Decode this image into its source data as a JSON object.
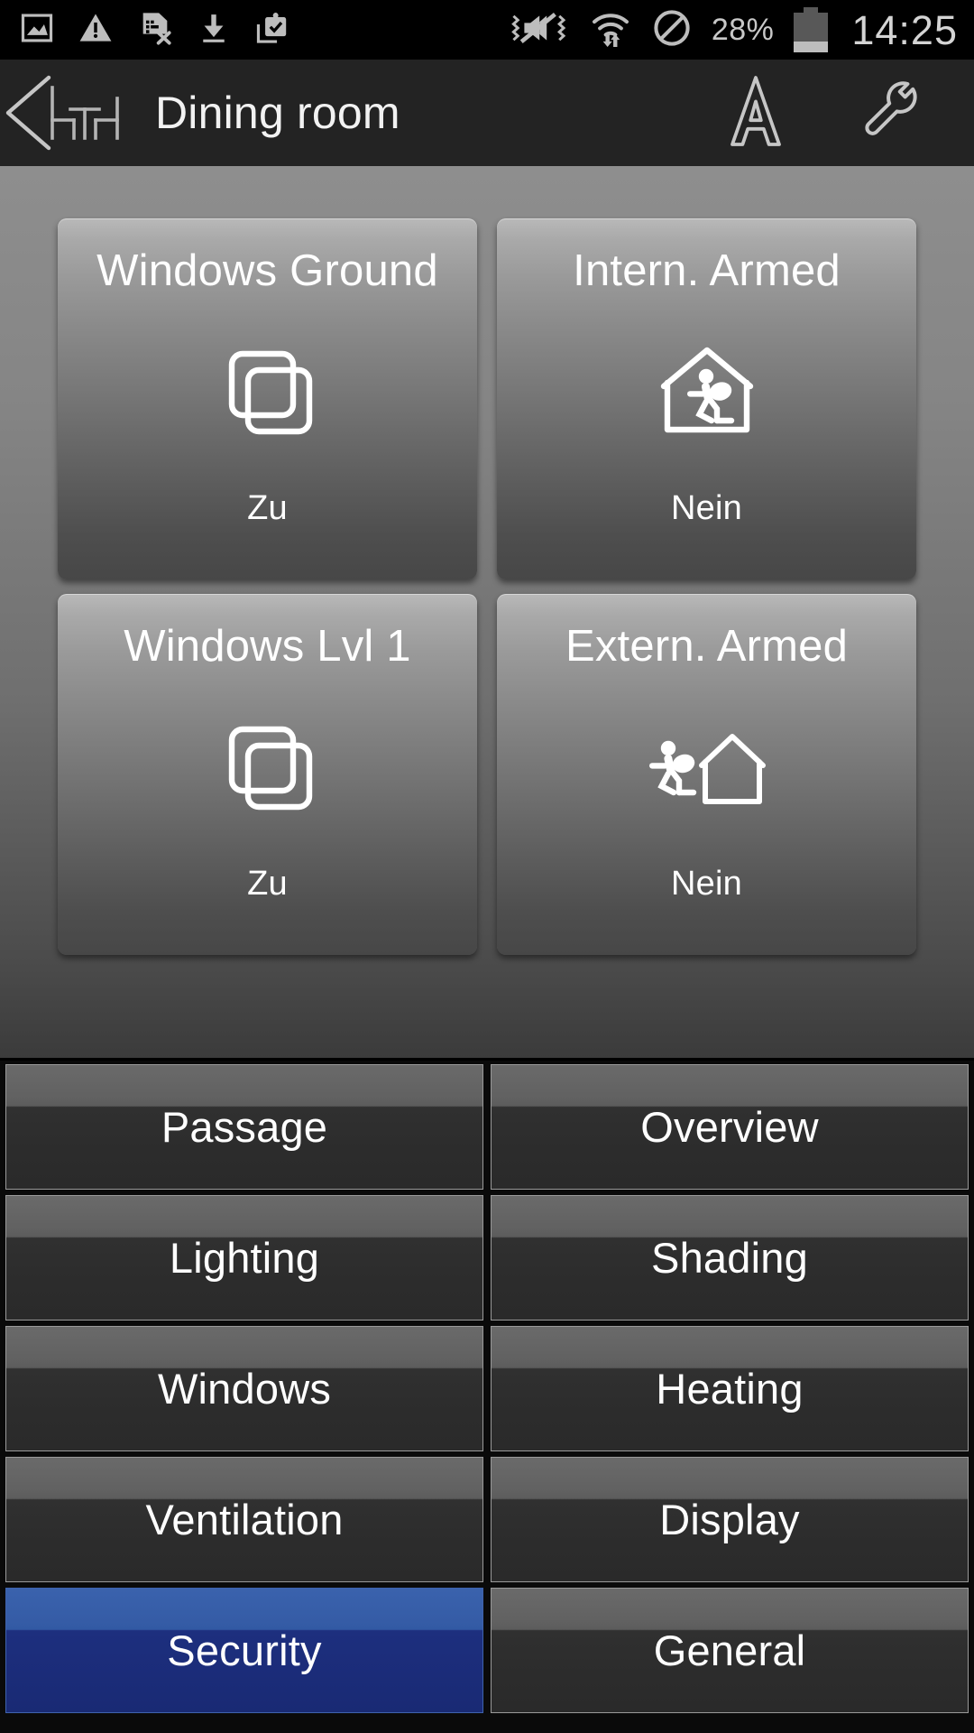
{
  "statusbar": {
    "left_icons": [
      "image-icon",
      "warning-icon",
      "sim-card-error-icon",
      "download-icon",
      "clipboard-check-icon"
    ],
    "right_icons": [
      "vibrate-mute-icon",
      "wifi-data-icon",
      "do-not-disturb-icon"
    ],
    "battery_percent": "28%",
    "battery_level": 28,
    "clock": "14:25"
  },
  "titlebar": {
    "back_icon": "back-arrow-icon",
    "logo_icon": "hth-logo-icon",
    "title": "Dining room",
    "actions": [
      {
        "icon": "font-size-a-icon",
        "name": "font-size-button"
      },
      {
        "icon": "wrench-icon",
        "name": "settings-wrench-button"
      }
    ]
  },
  "tiles": [
    {
      "title": "Windows Ground",
      "icon": "windows-stack-icon",
      "value": "Zu"
    },
    {
      "title": "Intern. Armed",
      "icon": "house-person-inside-icon",
      "value": "Nein"
    },
    {
      "title": "Windows Lvl 1",
      "icon": "windows-stack-icon",
      "value": "Zu"
    },
    {
      "title": "Extern. Armed",
      "icon": "house-person-outside-icon",
      "value": "Nein"
    }
  ],
  "nav": {
    "items": [
      {
        "label": "Passage",
        "active": false
      },
      {
        "label": "Overview",
        "active": false
      },
      {
        "label": "Lighting",
        "active": false
      },
      {
        "label": "Shading",
        "active": false
      },
      {
        "label": "Windows",
        "active": false
      },
      {
        "label": "Heating",
        "active": false
      },
      {
        "label": "Ventilation",
        "active": false
      },
      {
        "label": "Display",
        "active": false
      },
      {
        "label": "Security",
        "active": true
      },
      {
        "label": "General",
        "active": false
      }
    ]
  },
  "colors": {
    "accent_blue_top": "#3a62ad",
    "accent_blue_bottom": "#192a74",
    "status_bar_bg": "#000000",
    "title_bar_bg": "#232323",
    "text_white": "#ffffff",
    "status_text": "#c8c8c8"
  }
}
